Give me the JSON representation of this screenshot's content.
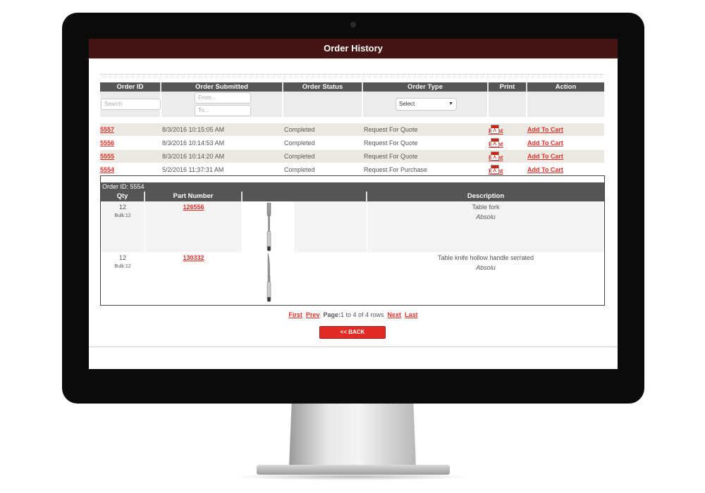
{
  "page": {
    "title": "Order History"
  },
  "table": {
    "headers": [
      "Order ID",
      "Order Submitted",
      "Order Status",
      "Order Type",
      "Print",
      "Action"
    ],
    "filters": {
      "search_placeholder": "Search",
      "from_placeholder": "From...",
      "to_placeholder": "To...",
      "type_select": "Select"
    },
    "rows": [
      {
        "id": "5557",
        "submitted": "8/3/2016 10:15:05 AM",
        "status": "Completed",
        "type": "Request For Quote",
        "print": "Print",
        "action": "Add To Cart"
      },
      {
        "id": "5556",
        "submitted": "8/3/2016 10:14:53 AM",
        "status": "Completed",
        "type": "Request For Quote",
        "print": "Print",
        "action": "Add To Cart"
      },
      {
        "id": "5555",
        "submitted": "8/3/2016 10:14:20 AM",
        "status": "Completed",
        "type": "Request For Quote",
        "print": "Print",
        "action": "Add To Cart"
      },
      {
        "id": "5554",
        "submitted": "5/2/2016 11:37:31 AM",
        "status": "Completed",
        "type": "Request For Purchase",
        "print": "Print",
        "action": "Add To Cart"
      }
    ]
  },
  "detail": {
    "title": "Order ID: 5554",
    "headers": [
      "Qty",
      "Part Number",
      "",
      "Description"
    ],
    "items": [
      {
        "qty": "12",
        "bulk": "Bulk:12",
        "part": "126556",
        "image": "fork-icon",
        "desc": "Table fork",
        "brand": "Absolu"
      },
      {
        "qty": "12",
        "bulk": "Bulk:12",
        "part": "130332",
        "image": "knife-icon",
        "desc": "Table knife hollow handle serrated",
        "brand": "Absolu"
      }
    ]
  },
  "pagination": {
    "first": "First",
    "prev": "Prev",
    "label": "Page:",
    "info": "1 to 4 of 4 rows",
    "next": "Next",
    "last": "Last"
  },
  "back_label": "<< BACK",
  "colors": {
    "titlebar": "#451515",
    "link": "#e0302a",
    "button": "#e32b25",
    "header": "#555555"
  }
}
